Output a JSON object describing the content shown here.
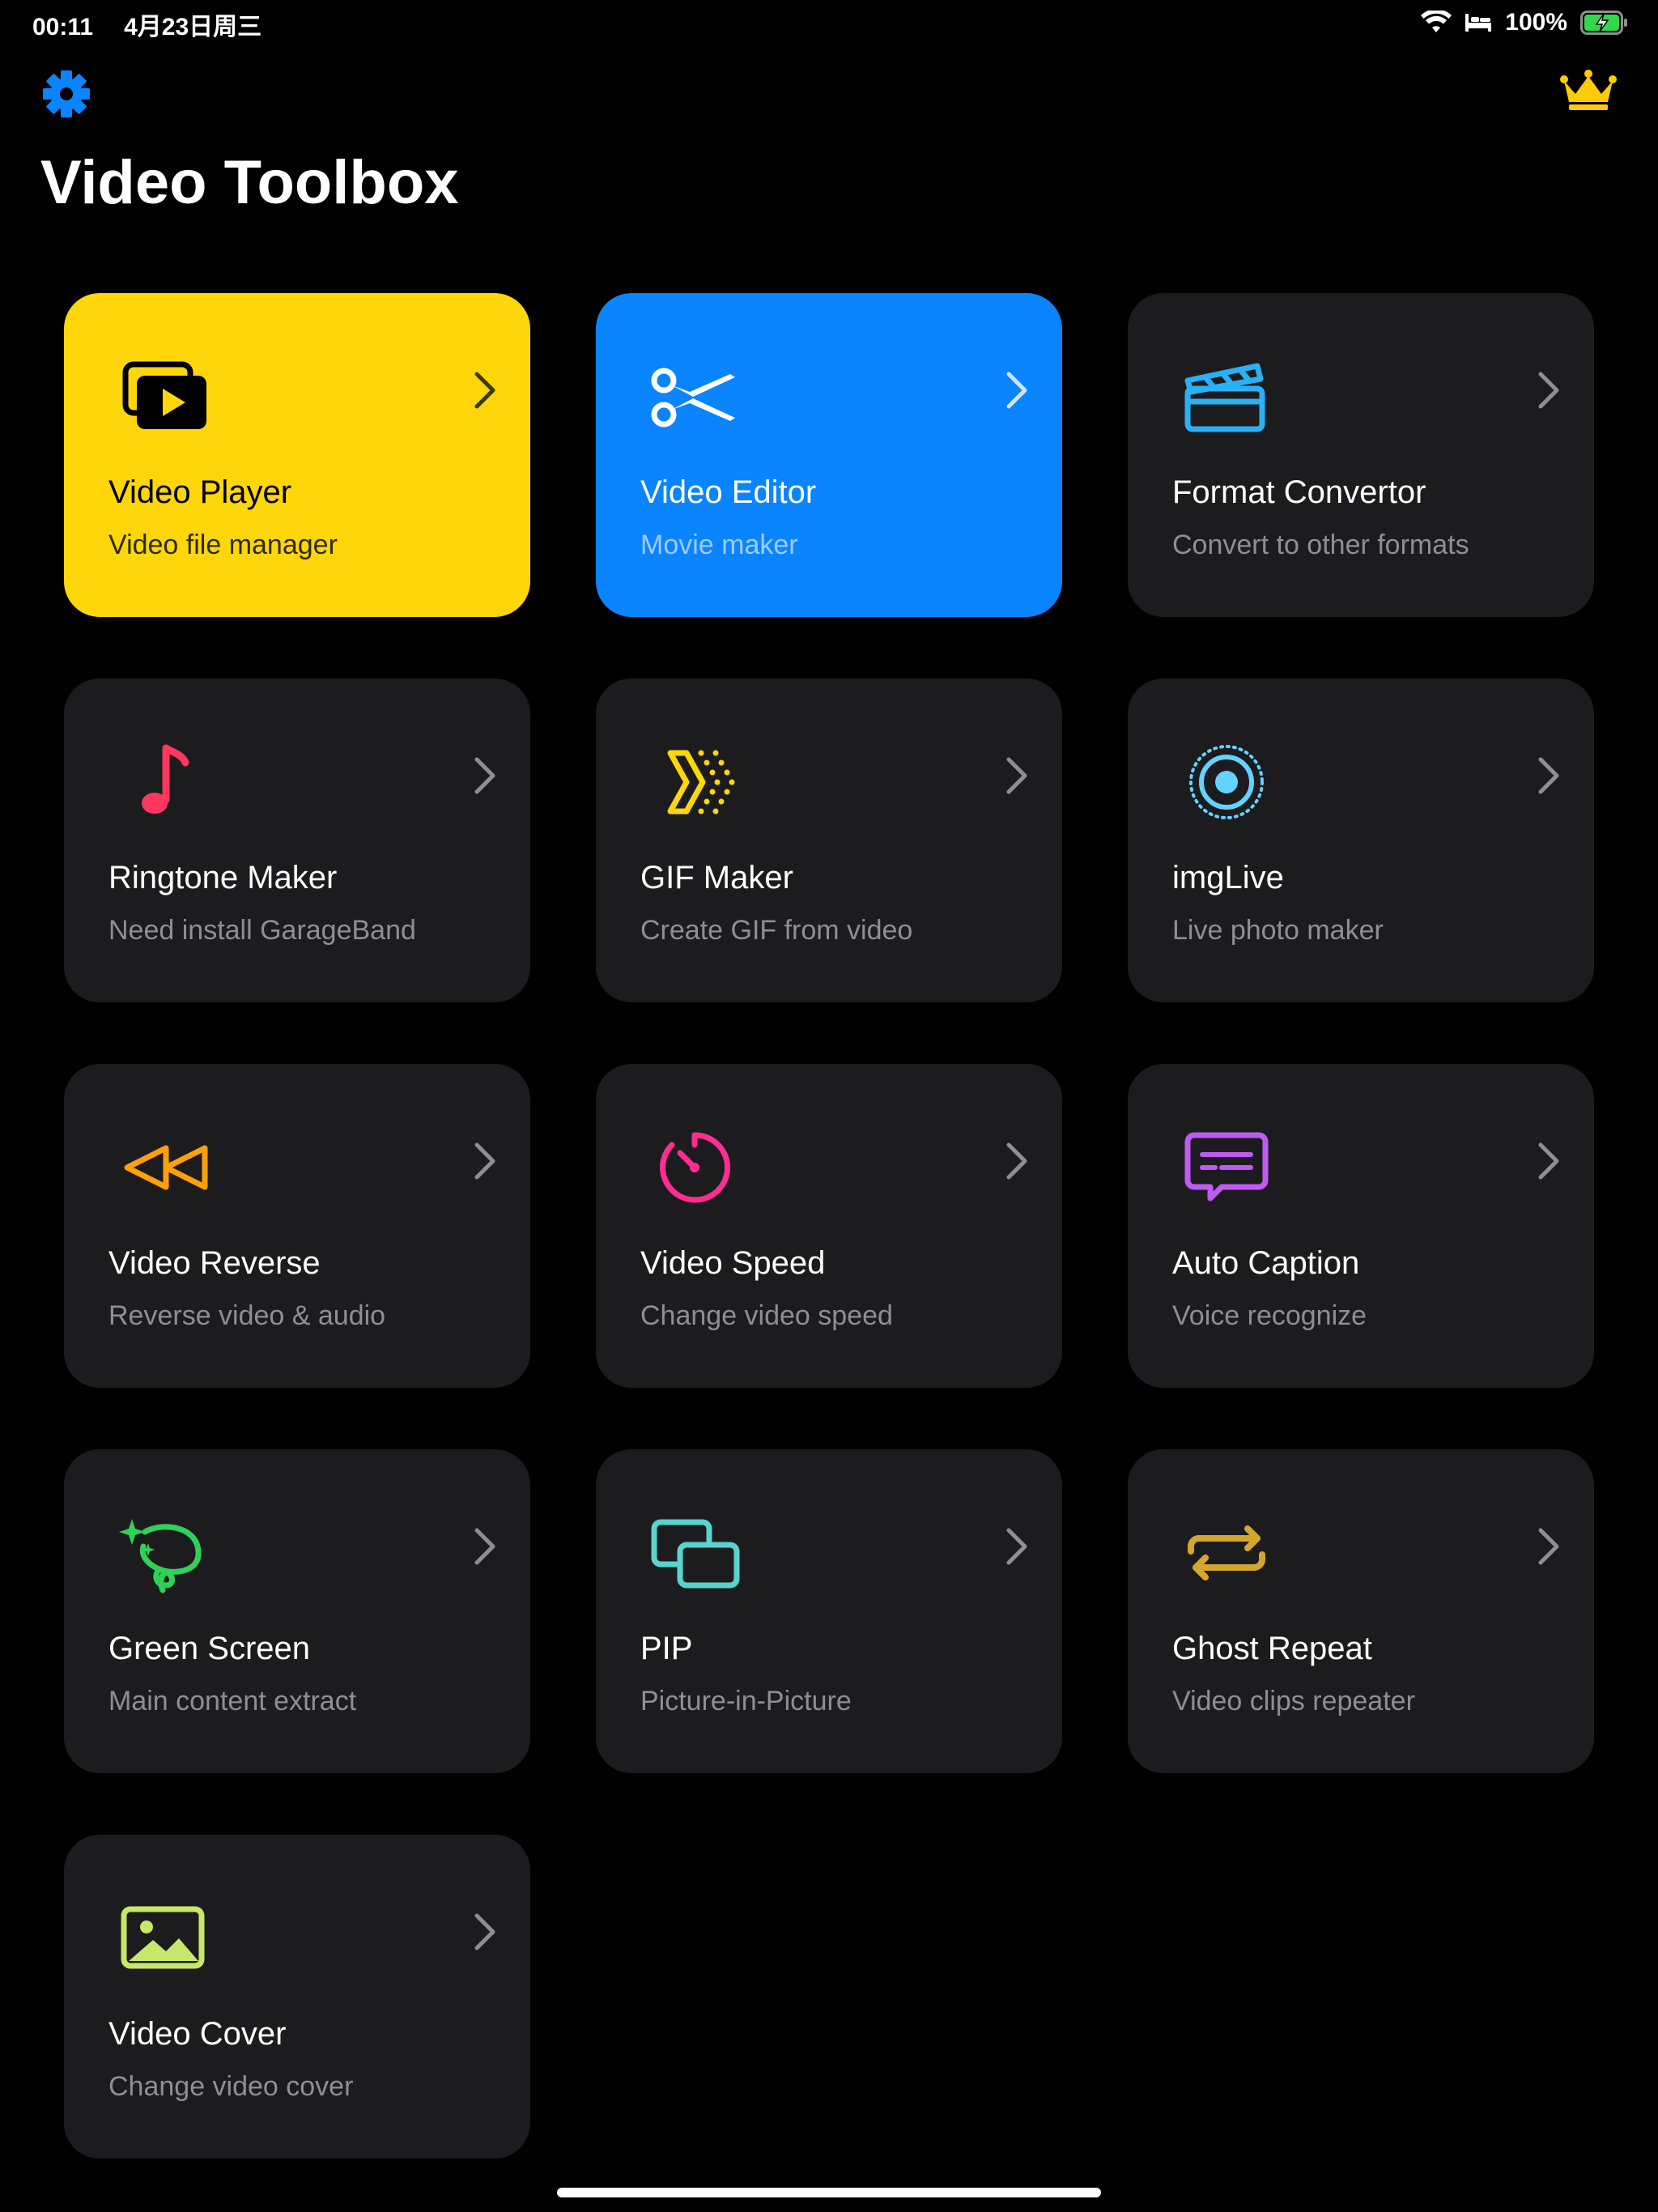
{
  "status_bar": {
    "time": "00:11",
    "date": "4月23日周三",
    "battery": "100%"
  },
  "header": {
    "title": "Video Toolbox",
    "settings_icon": "gear-icon",
    "premium_icon": "crown-icon"
  },
  "colors": {
    "accent_blue": "#0a84ff",
    "accent_yellow": "#ffd60a",
    "card_bg": "#1c1c1e"
  },
  "tools": [
    {
      "title": "Video Player",
      "subtitle": "Video file manager",
      "icon": "video-files-icon"
    },
    {
      "title": "Video Editor",
      "subtitle": "Movie maker",
      "icon": "scissors-icon"
    },
    {
      "title": "Format Convertor",
      "subtitle": "Convert to other formats",
      "icon": "clapperboard-icon"
    },
    {
      "title": "Ringtone Maker",
      "subtitle": "Need install GarageBand",
      "icon": "music-note-icon"
    },
    {
      "title": "GIF Maker",
      "subtitle": "Create GIF from video",
      "icon": "gif-diamond-icon"
    },
    {
      "title": "imgLive",
      "subtitle": "Live photo maker",
      "icon": "live-photo-icon"
    },
    {
      "title": "Video Reverse",
      "subtitle": "Reverse video & audio",
      "icon": "rewind-icon"
    },
    {
      "title": "Video Speed",
      "subtitle": "Change video speed",
      "icon": "timer-icon"
    },
    {
      "title": "Auto Caption",
      "subtitle": "Voice recognize",
      "icon": "caption-bubble-icon"
    },
    {
      "title": "Green Screen",
      "subtitle": "Main content extract",
      "icon": "lasso-sparkles-icon"
    },
    {
      "title": "PIP",
      "subtitle": "Picture-in-Picture",
      "icon": "pip-icon"
    },
    {
      "title": "Ghost Repeat",
      "subtitle": "Video clips repeater",
      "icon": "repeat-icon"
    },
    {
      "title": "Video Cover",
      "subtitle": "Change video cover",
      "icon": "photo-icon"
    }
  ]
}
